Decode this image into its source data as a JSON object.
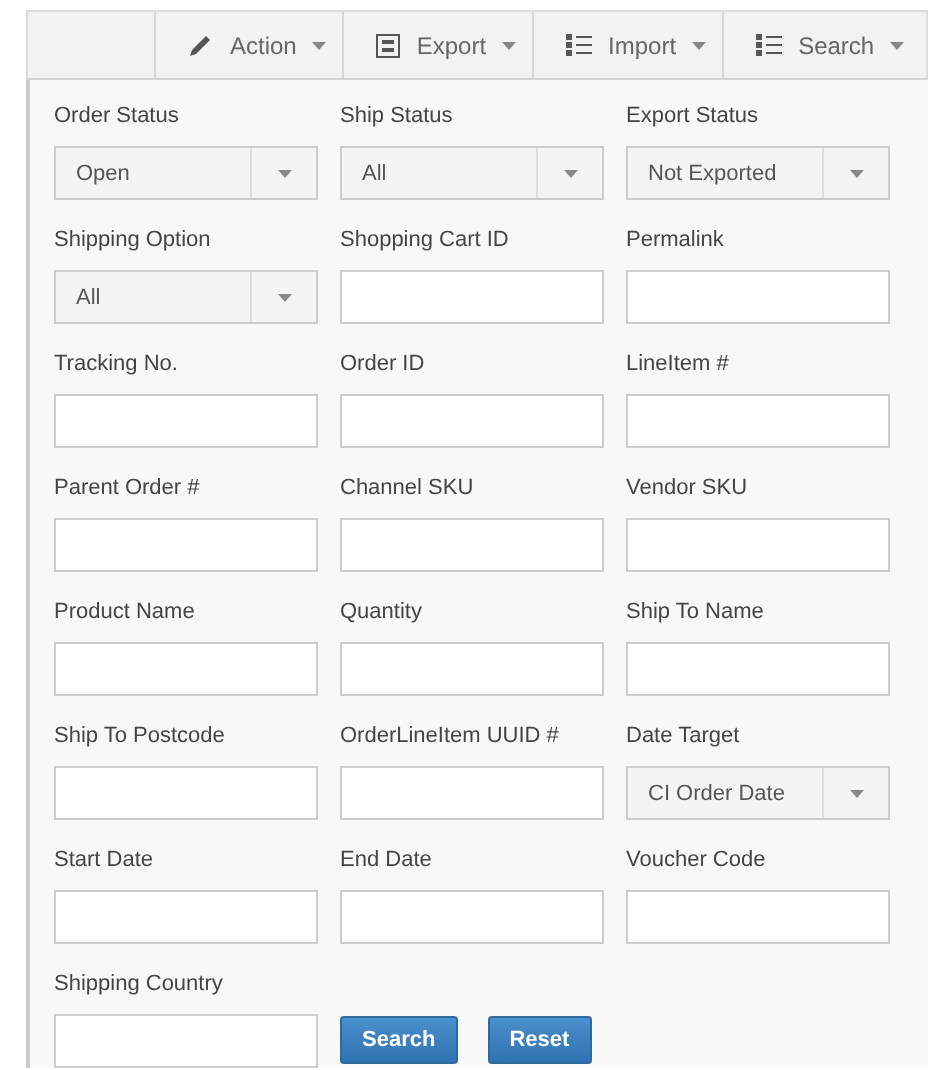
{
  "toolbar": [
    {
      "label": "Action",
      "kind": "pencil"
    },
    {
      "label": "Export",
      "kind": "cabinet"
    },
    {
      "label": "Import",
      "kind": "list"
    },
    {
      "label": "Search",
      "kind": "list"
    }
  ],
  "fields": [
    {
      "label": "Order Status",
      "kind": "select",
      "value": "Open"
    },
    {
      "label": "Ship Status",
      "kind": "select",
      "value": "All"
    },
    {
      "label": "Export Status",
      "kind": "select",
      "value": "Not Exported"
    },
    {
      "label": "Shipping Option",
      "kind": "select",
      "value": "All"
    },
    {
      "label": "Shopping Cart ID",
      "kind": "text"
    },
    {
      "label": "Permalink",
      "kind": "text"
    },
    {
      "label": "Tracking No.",
      "kind": "text"
    },
    {
      "label": "Order ID",
      "kind": "text"
    },
    {
      "label": "LineItem #",
      "kind": "text"
    },
    {
      "label": "Parent Order #",
      "kind": "text"
    },
    {
      "label": "Channel SKU",
      "kind": "text"
    },
    {
      "label": "Vendor SKU",
      "kind": "text"
    },
    {
      "label": "Product Name",
      "kind": "text"
    },
    {
      "label": "Quantity",
      "kind": "text"
    },
    {
      "label": "Ship To Name",
      "kind": "text"
    },
    {
      "label": "Ship To Postcode",
      "kind": "text"
    },
    {
      "label": "OrderLineItem UUID #",
      "kind": "text"
    },
    {
      "label": "Date Target",
      "kind": "select",
      "value": "CI Order Date"
    },
    {
      "label": "Start Date",
      "kind": "text"
    },
    {
      "label": "End Date",
      "kind": "text"
    },
    {
      "label": "Voucher Code",
      "kind": "text"
    },
    {
      "label": "Shipping Country",
      "kind": "text"
    }
  ],
  "buttons": [
    "Search",
    "Reset"
  ]
}
